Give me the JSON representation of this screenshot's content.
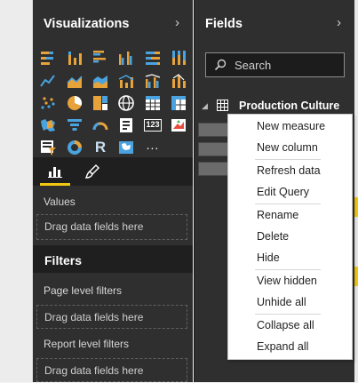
{
  "visualizations": {
    "title": "Visualizations",
    "icons": [
      "stacked-bar-icon",
      "stacked-column-icon",
      "clustered-bar-icon",
      "clustered-column-icon",
      "100-stacked-bar-icon",
      "100-stacked-column-icon",
      "line-chart-icon",
      "area-chart-icon",
      "stacked-area-icon",
      "line-column-chart-icon",
      "line-clustered-column-icon",
      "ribbon-chart-icon",
      "scatter-chart-icon",
      "pie-chart-icon",
      "treemap-icon",
      "map-icon",
      "table-icon",
      "matrix-icon",
      "filled-map-icon",
      "funnel-icon",
      "gauge-icon",
      "card-icon",
      "multi-row-card-icon",
      "kpi-icon",
      "slicer-icon",
      "donut-icon",
      "r-script-icon",
      "globe-map-icon",
      "more-icon"
    ],
    "r_glyph": "R",
    "multirow_glyph": "123",
    "more_glyph": "...",
    "values_label": "Values",
    "drop_hint": "Drag data fields here"
  },
  "filters": {
    "title": "Filters",
    "page_level": "Page level filters",
    "page_drop": "Drag data fields here",
    "report_level": "Report level filters",
    "report_drop": "Drag data fields here"
  },
  "fields": {
    "title": "Fields",
    "search_placeholder": "Search",
    "table_name": "Production Culture"
  },
  "context_menu": {
    "items": [
      "New measure",
      "New column",
      "Refresh data",
      "Edit Query",
      "Rename",
      "Delete",
      "Hide",
      "View hidden",
      "Unhide all",
      "Collapse all",
      "Expand all"
    ]
  },
  "colors": {
    "accent": "#f2c811",
    "pane_bg": "#2f2f2f",
    "menu_bg": "#ffffff"
  }
}
